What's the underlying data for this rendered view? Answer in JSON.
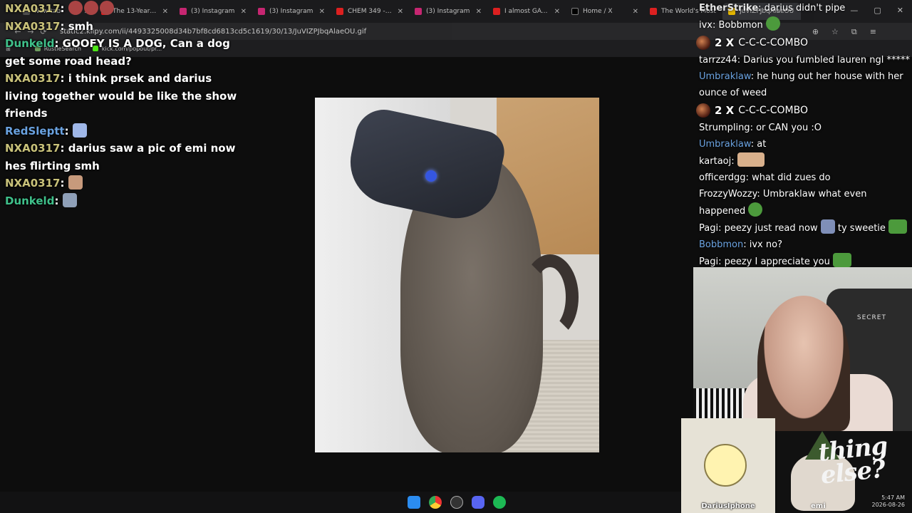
{
  "ui": {
    "sep": ": "
  },
  "browser": {
    "tabs": [
      "New tab",
      "The 13-Year Inve",
      "(3) Instagram",
      "(3) Instagram",
      "CHEM 349 - Gene",
      "(3) Instagram",
      "I almost GAVE UP",
      "Home / X",
      "The World's Most",
      "JuVIZPJbqAlaeOU"
    ],
    "url": "static2.klipy.com/ii/4493325008d34b7bf8cd6813cd5c1619/30/13/JuVIZPJbqAlaeOU.gif",
    "bookmarks": [
      "RustleSearch",
      "kick.com/popout/pr..."
    ]
  },
  "left_chat": [
    {
      "user": "NXA0317",
      "text": ""
    },
    {
      "user": "NXA0317",
      "text": "smh"
    },
    {
      "user": "Dunkeld",
      "text": "GOOFY IS A DOG, Can a dog get some road head?"
    },
    {
      "user": "NXA0317",
      "text": "i think prsek and darius living together would be like the show friends"
    },
    {
      "user": "RedSleptt",
      "text": ""
    },
    {
      "user": "NXA0317",
      "text": "darius saw a pic of emi now hes flirting smh"
    },
    {
      "user": "NXA0317",
      "text": ""
    },
    {
      "user": "Dunkeld",
      "text": ""
    }
  ],
  "right_chat": [
    {
      "user": "EtherStrike",
      "text": "darius didn't pipe"
    },
    {
      "user": "ivx",
      "text": "Bobbmon"
    },
    {
      "count": "2 X",
      "label": "C-C-C-COMBO"
    },
    {
      "user": "tarrzz44",
      "text": "Darius you fumbled lauren ngl *****"
    },
    {
      "user": "Umbraklaw",
      "text": "he hung out her house with her ounce of weed"
    },
    {
      "count": "2 X",
      "label": "C-C-C-COMBO"
    },
    {
      "user": "Strumpling",
      "text": "or CAN you :O"
    },
    {
      "user": "Umbraklaw",
      "text": "at"
    },
    {
      "user": "kartaoj",
      "text": ""
    },
    {
      "user": "officerdgg",
      "text": "what did zues do"
    },
    {
      "user": "FrozzyWozzy",
      "text": "Umbraklaw what even happened"
    },
    {
      "user": "Pagi",
      "text": "peezy just read now",
      "text2": "ty sweetie"
    },
    {
      "user": "Bobbmon",
      "text": "ivx no?"
    },
    {
      "user": "Pagi",
      "text": "peezy I appreciate you"
    }
  ],
  "webcam": {
    "chair_brand": "SECRET"
  },
  "overlays": {
    "friend_label": "DariusIphone",
    "script_text": "thing else?",
    "emi_label": "emi"
  },
  "taskbar": {
    "time": "5:47 AM",
    "date": "2026-08-26"
  },
  "colors": {
    "username_yellow": "#c9c27a",
    "username_green": "#3fc08a",
    "username_blue": "#6aa2e0"
  }
}
